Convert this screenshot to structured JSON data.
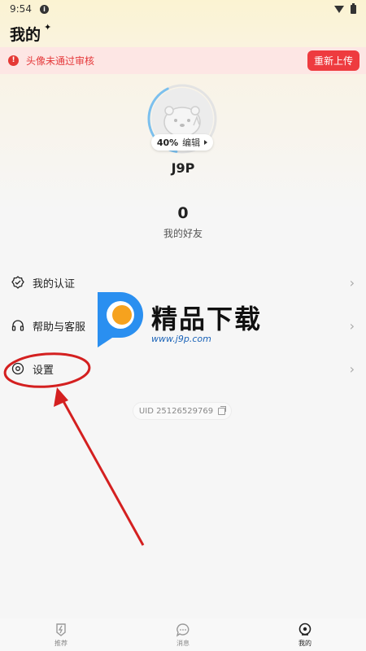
{
  "status_bar": {
    "time": "9:54"
  },
  "header": {
    "title": "我的"
  },
  "alert": {
    "message": "头像未通过审核",
    "button_label": "重新上传"
  },
  "profile": {
    "completion": "40%",
    "completion_fraction": 0.4,
    "edit_label": "编辑",
    "username": "J9P",
    "friend_count": "0",
    "friend_label": "我的好友"
  },
  "menu": {
    "items": [
      {
        "label": "我的认证",
        "icon": "verified-check-icon"
      },
      {
        "label": "帮助与客服",
        "icon": "headset-icon"
      },
      {
        "label": "设置",
        "icon": "settings-icon"
      }
    ]
  },
  "uid": {
    "text": "UID 25126529769"
  },
  "watermark": {
    "title": "精品下载",
    "url": "www.j9p.com"
  },
  "tabbar": {
    "items": [
      {
        "label": "推荐",
        "icon": "lightning-icon"
      },
      {
        "label": "消息",
        "icon": "chat-icon"
      },
      {
        "label": "我的",
        "icon": "profile-icon"
      }
    ]
  },
  "colors": {
    "alert_red": "#ee3b3f",
    "progress_blue": "#7cc0ee",
    "annotation_red": "#d42020"
  }
}
